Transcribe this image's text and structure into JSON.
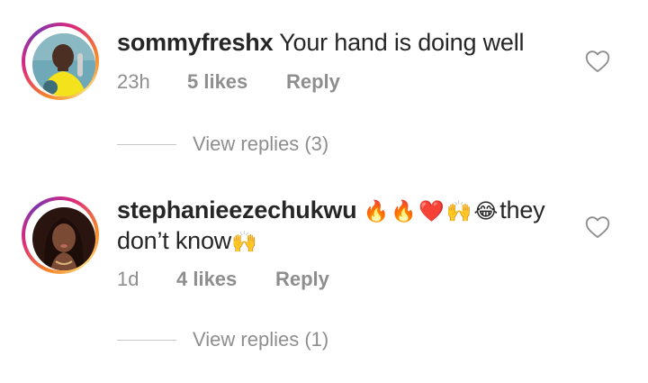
{
  "comments": [
    {
      "username": "sommyfreshx",
      "text": "Your hand is doing well",
      "emoji_text": "",
      "text_after": "",
      "time": "23h",
      "likes": "5 likes",
      "reply_label": "Reply",
      "view_replies": "View replies (3)"
    },
    {
      "username": "stephanieezechukwu",
      "emoji_text": "🔥🔥❤️🙌😂",
      "text": "they don’t know",
      "text_after": "🙌",
      "time": "1d",
      "likes": "4 likes",
      "reply_label": "Reply",
      "view_replies": "View replies (1)"
    }
  ],
  "icons": {
    "like": "heart-outline-icon"
  },
  "colors": {
    "text": "#262626",
    "meta": "#8e8e8e",
    "ring_start": "#f58529",
    "ring_end": "#dd2a7b"
  }
}
